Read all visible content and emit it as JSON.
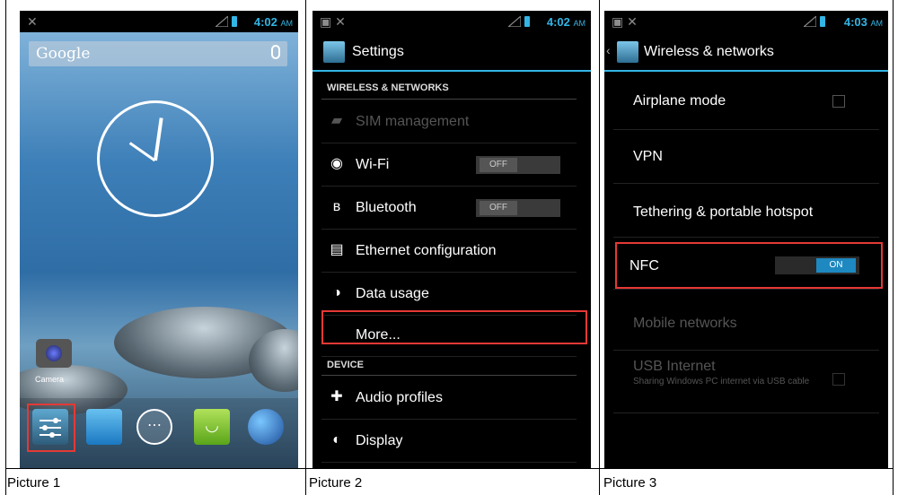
{
  "captions": [
    "Picture 1",
    "Picture 2",
    "Picture 3"
  ],
  "panel1": {
    "status_time": "4:02",
    "status_ampm": "AM",
    "google_label": "Google",
    "camera_label": "Camera"
  },
  "panel2": {
    "status_time": "4:02",
    "status_ampm": "AM",
    "title": "Settings",
    "section_wireless": "WIRELESS & NETWORKS",
    "items": [
      {
        "label": "SIM management",
        "disabled": true
      },
      {
        "label": "Wi-Fi",
        "toggle": "OFF"
      },
      {
        "label": "Bluetooth",
        "toggle": "OFF"
      },
      {
        "label": "Ethernet configuration"
      },
      {
        "label": "Data usage"
      },
      {
        "label": "More..."
      }
    ],
    "section_device": "DEVICE",
    "device_items": [
      {
        "label": "Audio profiles"
      },
      {
        "label": "Display"
      }
    ]
  },
  "panel3": {
    "status_time": "4:03",
    "status_ampm": "AM",
    "title": "Wireless & networks",
    "items": [
      {
        "label": "Airplane mode"
      },
      {
        "label": "VPN"
      },
      {
        "label": "Tethering & portable hotspot"
      },
      {
        "label": "NFC",
        "toggle": "ON"
      },
      {
        "label": "Mobile networks",
        "disabled": true
      },
      {
        "label": "USB Internet",
        "disabled": true,
        "summary": "Sharing Windows PC internet via USB cable"
      }
    ]
  },
  "colors": {
    "accent": "#33b5e5",
    "highlight": "#e53935"
  }
}
